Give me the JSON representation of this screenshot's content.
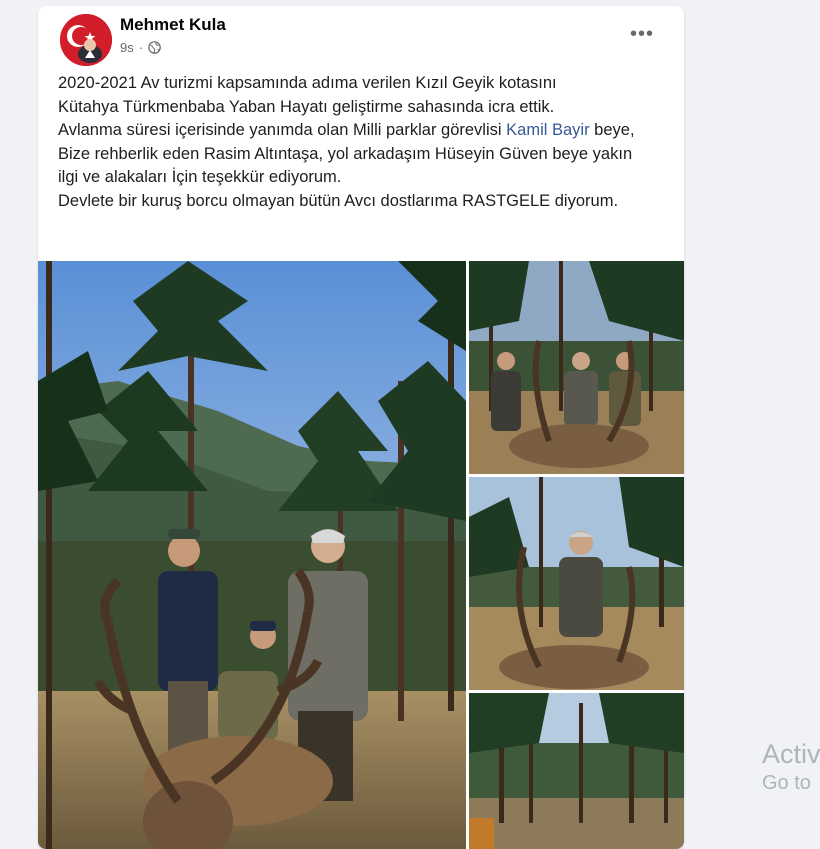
{
  "post": {
    "author": "Mehmet Kula",
    "time": "9s",
    "privacy_icon": "globe-icon",
    "more_icon": "more-options-icon",
    "text": {
      "line1": "2020-2021 Av turizmi kapsamında adıma verilen Kızıl Geyik kotasını",
      "line2": "Kütahya Türkmenbaba Yaban Hayatı geliştirme sahasında icra ettik.",
      "line3": "Avlanma süresi içerisinde yanımda olan Milli parklar görevlisi ",
      "mention": "Kamil Bayir",
      "line4": " beye, Bize rehberlik eden Rasim Altıntaşa, yol arkadaşım Hüseyin Güven beye yakın ilgi ve alakaları İçin teşekkür ediyorum.",
      "line5": "Devlete bir kuruş borcu olmayan bütün Avcı dostlarıma RASTGELE diyorum."
    }
  },
  "watermark": {
    "title": "Activ",
    "subtitle": "Go to"
  },
  "colors": {
    "background": "#f0f2f5",
    "card": "#ffffff",
    "link": "#385898",
    "text": "#1c1e21",
    "secondary": "#65676b"
  }
}
